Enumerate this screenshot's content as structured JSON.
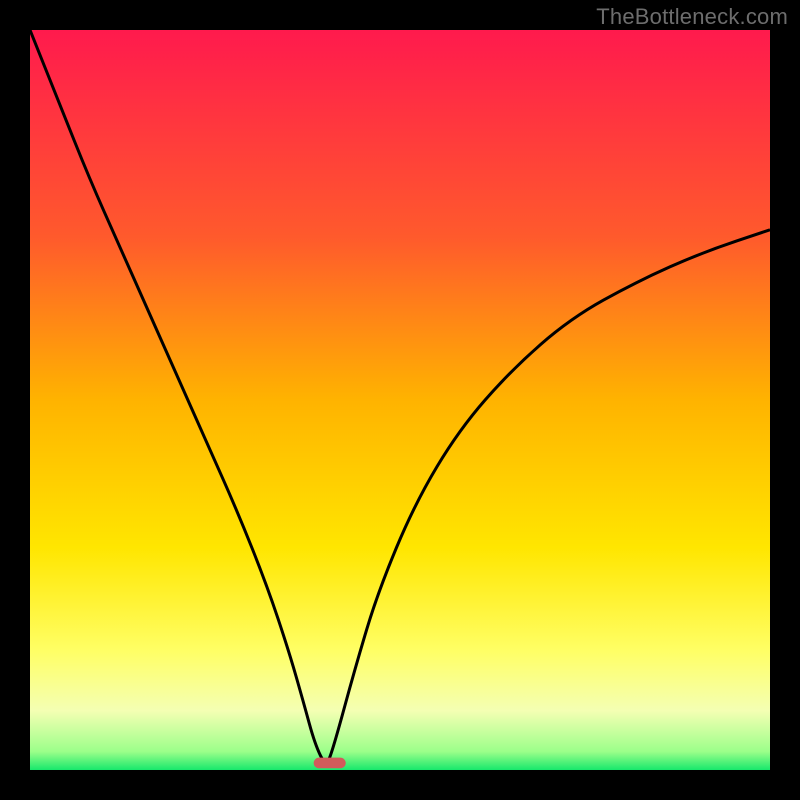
{
  "attribution": "TheBottleneck.com",
  "colors": {
    "frame": "#000000",
    "gradient_stops": [
      {
        "offset": 0.0,
        "color": "#ff1a4d"
      },
      {
        "offset": 0.28,
        "color": "#ff5a2c"
      },
      {
        "offset": 0.5,
        "color": "#ffb300"
      },
      {
        "offset": 0.7,
        "color": "#ffe600"
      },
      {
        "offset": 0.84,
        "color": "#ffff66"
      },
      {
        "offset": 0.92,
        "color": "#f4ffb3"
      },
      {
        "offset": 0.975,
        "color": "#9cff8a"
      },
      {
        "offset": 1.0,
        "color": "#17e86c"
      }
    ],
    "curve": "#000000",
    "marker_fill": "#d25b5b",
    "marker_stroke": "#d25b5b"
  },
  "chart_data": {
    "type": "line",
    "title": "",
    "xlabel": "",
    "ylabel": "",
    "xlim": [
      0,
      100
    ],
    "ylim": [
      0,
      100
    ],
    "grid": false,
    "legend": false,
    "annotations": [],
    "series": [
      {
        "name": "bottleneck-curve",
        "x": [
          0,
          4,
          8,
          12,
          16,
          20,
          24,
          28,
          32,
          35,
          37,
          38.5,
          40,
          41,
          44,
          47,
          52,
          58,
          65,
          73,
          82,
          91,
          100
        ],
        "y": [
          100,
          90,
          80,
          71,
          62,
          53,
          44,
          35,
          25,
          16,
          9,
          3.5,
          0.4,
          3,
          14,
          24,
          36,
          46,
          54,
          61,
          66,
          70,
          73
        ]
      }
    ],
    "marker": {
      "shape": "rounded-bar",
      "x_center": 40.5,
      "x_width": 4.2,
      "y": 0.3,
      "height": 1.3
    }
  }
}
